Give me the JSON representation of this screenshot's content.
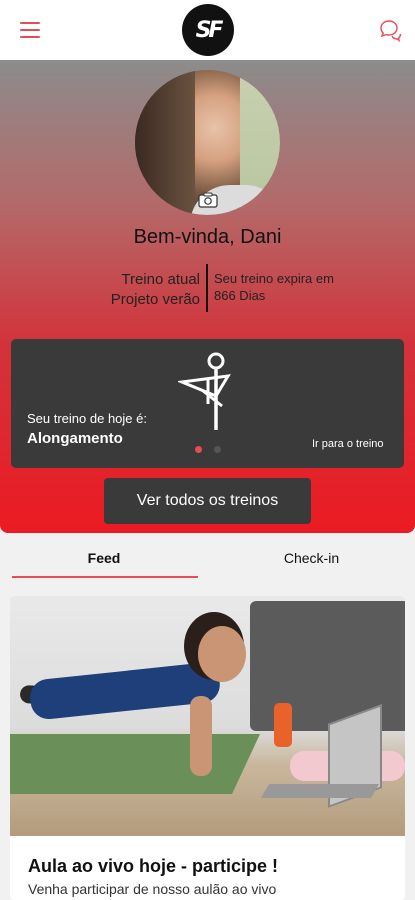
{
  "header": {
    "logo_text": "SF"
  },
  "profile": {
    "greeting": "Bem-vinda, Dani",
    "plan_label": "Treino atual",
    "plan_name": "Projeto verão",
    "expiry_text": "Seu treino expira em",
    "expiry_days": "866 Dias"
  },
  "workout": {
    "today_label": "Seu treino de hoje é:",
    "today_value": "Alongamento",
    "goto_link": "Ir para o treino"
  },
  "all_workouts_button": "Ver todos os treinos",
  "tabs": [
    {
      "label": "Feed",
      "active": true
    },
    {
      "label": "Check-in",
      "active": false
    }
  ],
  "feed": {
    "card_title": "Aula ao vivo hoje - participe !",
    "card_subtitle": "Venha participar de nosso aulão ao vivo"
  },
  "colors": {
    "accent": "#e94a57",
    "dark_card": "#3a3a3a"
  }
}
